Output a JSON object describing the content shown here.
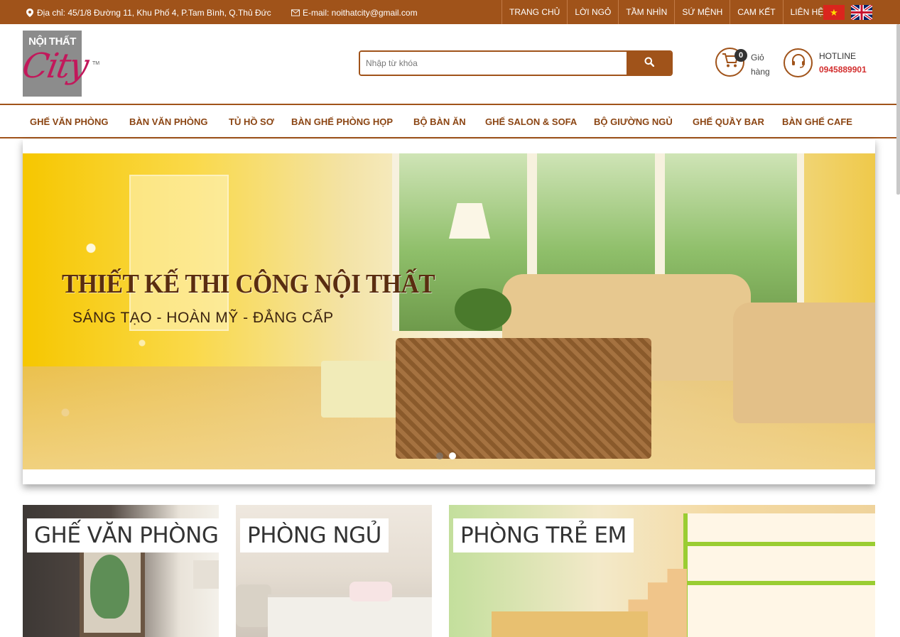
{
  "topbar": {
    "address": "Địa chỉ: 45/1/8 Đường 11, Khu Phố 4, P.Tam Bình, Q.Thủ Đức",
    "email": "E-mail: noithatcity@gmail.com",
    "nav": [
      "TRANG CHỦ",
      "LỜI NGỎ",
      "TẦM NHÌN",
      "SỨ MỆNH",
      "CAM KẾT",
      "LIÊN HỆ"
    ]
  },
  "logo": {
    "top_text": "NỘI THẤT",
    "script_text": "City",
    "tm": "TM"
  },
  "search": {
    "placeholder": "Nhập từ khóa"
  },
  "cart": {
    "count": "0",
    "label": "Giỏ hàng"
  },
  "hotline": {
    "label": "HOTLINE",
    "number": "0945889901"
  },
  "mainnav": [
    "GHẾ VĂN PHÒNG",
    "BÀN VĂN PHÒNG",
    "TỦ HỒ SƠ",
    "BÀN GHẾ PHÒNG HỌP",
    "BỘ BÀN ĂN",
    "GHẾ SALON & SOFA",
    "BỘ GIƯỜNG NGỦ",
    "GHẾ QUẦY BAR",
    "BÀN GHẾ CAFE"
  ],
  "banner": {
    "title": "THIẾT KẾ THI CÔNG NỘI THẤT",
    "subtitle": "SÁNG TẠO - HOÀN MỸ - ĐẲNG CẤP",
    "slide_count": 2,
    "active_slide": 2
  },
  "categories": [
    "GHẾ VĂN PHÒNG",
    "PHÒNG NGỦ",
    "PHÒNG TRẺ EM"
  ],
  "colors": {
    "brand": "#a0531a",
    "nav_text": "#8b4513",
    "hotline": "#d32f2f"
  }
}
